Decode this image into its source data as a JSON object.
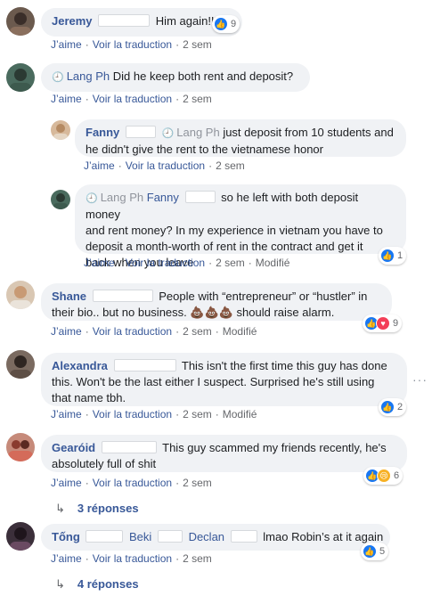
{
  "colors": {
    "link": "#385898",
    "bubble": "#f0f2f5",
    "meta": "#65676b",
    "like": "#1877f2"
  },
  "actions": {
    "like": "J’aime",
    "translate": "Voir la traduction",
    "sep": "·",
    "edited": "Modifié"
  },
  "comments": [
    {
      "name": "Jeremy",
      "text": "Him again!!!!!",
      "time": "2 sem",
      "reactions": "9"
    },
    {
      "name": "Lang Ph",
      "text": "Did he keep both rent and deposit?",
      "time": "2 sem"
    },
    {
      "name": "Fanny",
      "mention": "Lang Ph",
      "text_line1": "just deposit from 10 students and",
      "text_line2": "he didn't give the rent to the vietnamese honor",
      "time": "2 sem"
    },
    {
      "name": "Lang Ph",
      "mention": "Fanny",
      "text_line1": "so he left with both deposit money",
      "text_line2": "and rent money? In my experience in vietnam you have to",
      "text_line3": "deposit a month-worth of rent in the contract and get it",
      "text_line4": "back when you leave",
      "time": "2 sem",
      "reactions": "1"
    },
    {
      "name": "Shane",
      "text_line1": "People with “entrepreneur” or “hustler” in",
      "text_line2": "their bio.. but no business. 💩💩💩 should raise alarm.",
      "time": "2 sem",
      "reactions": "9"
    },
    {
      "name": "Alexandra",
      "text_line1": "This isn't the first time this guy has done",
      "text_line2": "this. Won't be the last either I suspect. Surprised he's still using",
      "text_line3": "that name tbh.",
      "time": "2 sem",
      "reactions": "2"
    },
    {
      "name": "Gearóid",
      "text_line1": "This guy scammed my friends recently, he's",
      "text_line2": "absolutely full of shit",
      "time": "2 sem",
      "reactions": "6",
      "replies": "3 réponses"
    },
    {
      "name": "Tống",
      "mention1": "Beki",
      "mention2": "Declan",
      "text": "lmao Robin’s at it again",
      "time": "2 sem",
      "reactions": "5",
      "replies": "4 réponses"
    }
  ]
}
